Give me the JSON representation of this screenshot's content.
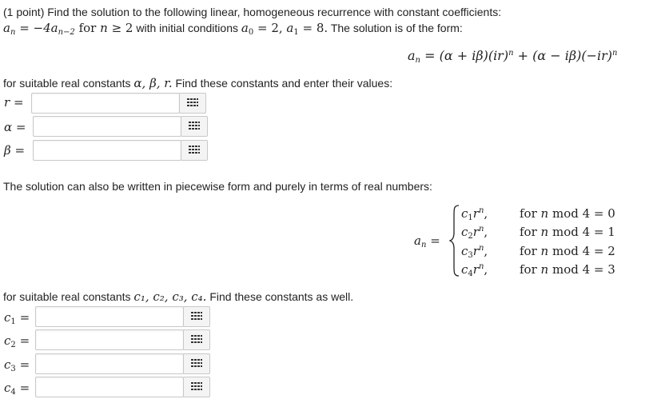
{
  "problem": {
    "points": "(1 point)",
    "intro": "Find the solution to the following linear, homogeneous recurrence with constant coefficients:",
    "recurrence": {
      "lhs": "a",
      "lhs_sub": "n",
      "eq": "=",
      "rhs_coef": "−4a",
      "rhs_sub": "n−2",
      "for_text": "for",
      "n_var": "n",
      "cond": "≥ 2",
      "ic_text": "with initial conditions",
      "a0": "a",
      "a0_sub": "0",
      "a0_val": "= 2,",
      "a1": "a",
      "a1_sub": "1",
      "a1_val": "= 8.",
      "form_text": "The solution is of the form:"
    },
    "form_formula": {
      "a": "a",
      "sub": "n",
      "rest_1": "= (α + iβ)(ir)",
      "sup1": "n",
      "rest_2": " + (α − iβ)(−ir)",
      "sup2": "n"
    },
    "suitable_1": {
      "pre": "for suitable real constants",
      "vars": "α, β, r.",
      "post": "Find these constants and enter their values:"
    },
    "fields_1": [
      {
        "label_var": "r",
        "label_eq": "="
      },
      {
        "label_var": "α",
        "label_eq": "="
      },
      {
        "label_var": "β",
        "label_eq": "="
      }
    ],
    "piecewise_text": "The solution can also be written in piecewise form and purely in terms of real numbers:",
    "cases": {
      "lhs": "a",
      "lhs_sub": "n",
      "eq": "=",
      "rows": [
        {
          "c": "c",
          "c_sub": "1",
          "r": "r",
          "sup": "n",
          "comma": ",",
          "cond_for": "for",
          "cond_n": "n",
          "cond_mod": "mod 4 = 0"
        },
        {
          "c": "c",
          "c_sub": "2",
          "r": "r",
          "sup": "n",
          "comma": ",",
          "cond_for": "for",
          "cond_n": "n",
          "cond_mod": "mod 4 = 1"
        },
        {
          "c": "c",
          "c_sub": "3",
          "r": "r",
          "sup": "n",
          "comma": ",",
          "cond_for": "for",
          "cond_n": "n",
          "cond_mod": "mod 4 = 2"
        },
        {
          "c": "c",
          "c_sub": "4",
          "r": "r",
          "sup": "n",
          "comma": ",",
          "cond_for": "for",
          "cond_n": "n",
          "cond_mod": "mod 4 = 3"
        }
      ]
    },
    "suitable_2": {
      "pre": "for suitable real constants",
      "vars": "c₁, c₂, c₃, c₄.",
      "post": "Find these constants as well."
    },
    "fields_2": [
      {
        "label_var": "c",
        "label_sub": "1",
        "label_eq": "="
      },
      {
        "label_var": "c",
        "label_sub": "2",
        "label_eq": "="
      },
      {
        "label_var": "c",
        "label_sub": "3",
        "label_eq": "="
      },
      {
        "label_var": "c",
        "label_sub": "4",
        "label_eq": "="
      }
    ],
    "icons": {
      "grid": "grid-icon",
      "brace": "left-brace-icon"
    }
  }
}
